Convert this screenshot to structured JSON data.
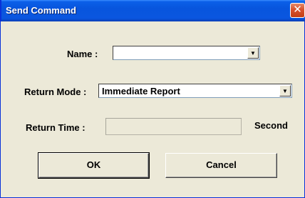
{
  "window": {
    "title": "Send Command",
    "close_glyph": "✕"
  },
  "form": {
    "name_label": "Name :",
    "name_value": "",
    "return_mode_label": "Return Mode :",
    "return_mode_value": "Immediate Report",
    "return_time_label": "Return Time :",
    "return_time_value": "",
    "return_time_unit": "Second",
    "dropdown_glyph": "▼"
  },
  "buttons": {
    "ok_label": "OK",
    "cancel_label": "Cancel"
  },
  "colors": {
    "titlebar": "#0855dd",
    "dialog_bg": "#ece9d8",
    "close_button": "#d9512c"
  }
}
